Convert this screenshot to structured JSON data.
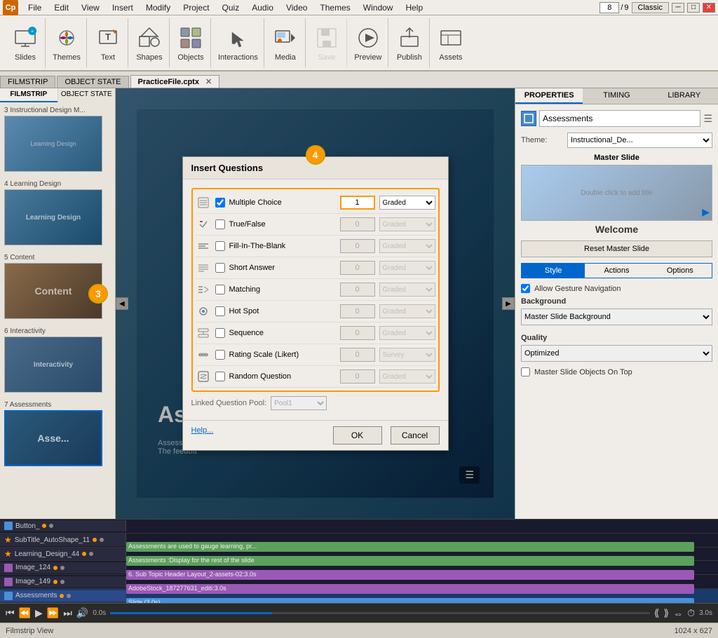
{
  "app": {
    "icon": "Cp",
    "menu_items": [
      "File",
      "Edit",
      "View",
      "Insert",
      "Modify",
      "Project",
      "Quiz",
      "Audio",
      "Video",
      "Themes",
      "Window",
      "Help"
    ],
    "slide_current": "8",
    "slide_total": "9",
    "view_mode": "Classic"
  },
  "toolbar": {
    "groups": [
      {
        "label": "Slides",
        "icon": "slides"
      },
      {
        "label": "Themes",
        "icon": "themes"
      },
      {
        "label": "Text",
        "icon": "text"
      },
      {
        "label": "Shapes",
        "icon": "shapes"
      },
      {
        "label": "Objects",
        "icon": "objects"
      },
      {
        "label": "Interactions",
        "icon": "interactions"
      },
      {
        "label": "Media",
        "icon": "media"
      },
      {
        "label": "Save",
        "icon": "save",
        "disabled": true
      },
      {
        "label": "Preview",
        "icon": "preview"
      },
      {
        "label": "Publish",
        "icon": "publish"
      },
      {
        "label": "Assets",
        "icon": "assets"
      }
    ]
  },
  "tabs": {
    "filmstrip": "FILMSTRIP",
    "object_state": "OBJECT STATE",
    "file": "PracticeFile.cptx"
  },
  "filmstrip": {
    "slides": [
      {
        "num": "3",
        "label": "3 Instructional Design M...",
        "color": "#5a8ab0"
      },
      {
        "num": "4",
        "label": "4 Learning Design",
        "color": "#4a7a9b"
      },
      {
        "num": "5",
        "label": "5 Content",
        "color": "#8a6a4a"
      },
      {
        "num": "6",
        "label": "6 Interactivity",
        "color": "#4a6a8a"
      },
      {
        "num": "7",
        "label": "7 Assessments",
        "color": "#2a5a7a",
        "active": true
      }
    ]
  },
  "properties": {
    "panel_title": "Assessments",
    "theme_label": "Theme:",
    "theme_value": "Instructional_De...",
    "master_slide_label": "Master Slide",
    "master_slide_hint": "Double click to add title",
    "welcome": "Welcome",
    "reset_master_btn": "Reset Master Slide",
    "tabs": [
      "Style",
      "Actions",
      "Options"
    ],
    "active_tab": "Style",
    "allow_gesture": "Allow Gesture Navigation",
    "background_label": "Background",
    "background_value": "Master Slide Background",
    "quality_label": "Quality",
    "quality_value": "Optimized",
    "master_objects_top": "Master Slide Objects On Top"
  },
  "dialog": {
    "title": "Insert Questions",
    "step4_badge": "4",
    "step3_badge": "3",
    "questions": [
      {
        "id": "multiple_choice",
        "label": "Multiple Choice",
        "checked": true,
        "count": "1",
        "type": "Graded",
        "enabled": true
      },
      {
        "id": "true_false",
        "label": "True/False",
        "checked": false,
        "count": "0",
        "type": "Graded",
        "enabled": false
      },
      {
        "id": "fill_blank",
        "label": "Fill-In-The-Blank",
        "checked": false,
        "count": "0",
        "type": "Graded",
        "enabled": false
      },
      {
        "id": "short_answer",
        "label": "Short Answer",
        "checked": false,
        "count": "0",
        "type": "Graded",
        "enabled": false
      },
      {
        "id": "matching",
        "label": "Matching",
        "checked": false,
        "count": "0",
        "type": "Graded",
        "enabled": false
      },
      {
        "id": "hot_spot",
        "label": "Hot Spot",
        "checked": false,
        "count": "0",
        "type": "Graded",
        "enabled": false
      },
      {
        "id": "sequence",
        "label": "Sequence",
        "checked": false,
        "count": "0",
        "type": "Graded",
        "enabled": false
      },
      {
        "id": "rating_scale",
        "label": "Rating Scale (Likert)",
        "checked": false,
        "count": "0",
        "type": "Survey",
        "enabled": false
      },
      {
        "id": "random_question",
        "label": "Random Question",
        "checked": false,
        "count": "0",
        "type": "Graded",
        "enabled": false
      }
    ],
    "linked_pool_label": "Linked Question Pool:",
    "linked_pool_value": "Pool1",
    "help_label": "Help...",
    "ok_label": "OK",
    "cancel_label": "Cancel"
  },
  "canvas": {
    "slide_title": "Assess",
    "slide_subtitle": "Assessments\nThe feedba"
  },
  "timeline": {
    "rows": [
      {
        "label": "Button_",
        "type": "button",
        "bar_color": "#4a90d9",
        "bar_left": "0%",
        "bar_width": "60%"
      },
      {
        "label": "SubTitle_AutoShape_11",
        "type": "star",
        "bar_color": "#5ba05b",
        "bar_left": "0%",
        "bar_width": "100%",
        "text": "Assessments are used to gauge learning, pr..."
      },
      {
        "label": "Learning_Design_44",
        "type": "star",
        "bar_color": "#5ba05b",
        "bar_left": "0%",
        "bar_width": "100%",
        "text": "Assessments :Display for the rest of the slide"
      },
      {
        "label": "Image_124",
        "type": "image",
        "bar_color": "#9b59b6",
        "bar_left": "0%",
        "bar_width": "100%",
        "text": "6. Sub Topic Header Layout_2-assets-02:3.0s"
      },
      {
        "label": "Image_149",
        "type": "image",
        "bar_color": "#9b59b6",
        "bar_left": "0%",
        "bar_width": "100%",
        "text": "AdobeStock_187277631_editi:3.0s"
      },
      {
        "label": "Assessments",
        "type": "button",
        "bar_color": "#4a90d9",
        "bar_left": "0%",
        "bar_width": "100%",
        "text": "Slide (3.0s)",
        "active": true
      }
    ],
    "time_start": "0.0s",
    "time_end": "3.0s",
    "controls": [
      "prev",
      "play",
      "next",
      "end",
      "volume"
    ]
  },
  "status_bar": {
    "view_label": "Filmstrip View",
    "dimensions": "1024 x 627"
  }
}
